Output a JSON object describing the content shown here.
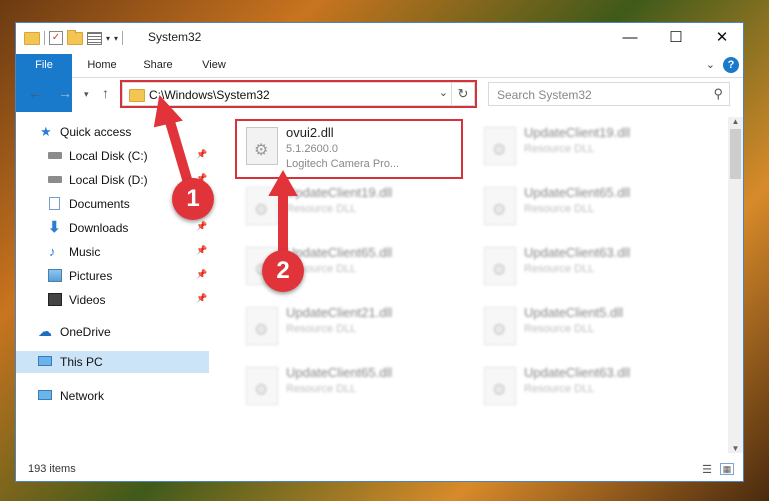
{
  "window": {
    "title": "System32",
    "minimize": "—",
    "maximize": "☐",
    "close": "✕"
  },
  "ribbon": {
    "tabs": [
      "File",
      "Home",
      "Share",
      "View"
    ],
    "help": "?"
  },
  "address": {
    "path": "C:\\Windows\\System32",
    "search_placeholder": "Search System32"
  },
  "nav": {
    "items": [
      {
        "label": "Quick access",
        "icon": "star-icon"
      },
      {
        "label": "Local Disk (C:)",
        "icon": "drive-icon",
        "pinned": true
      },
      {
        "label": "Local Disk (D:)",
        "icon": "drive-icon",
        "pinned": true
      },
      {
        "label": "Documents",
        "icon": "documents-icon",
        "pinned": true
      },
      {
        "label": "Downloads",
        "icon": "download-icon",
        "pinned": true
      },
      {
        "label": "Music",
        "icon": "music-icon",
        "pinned": true
      },
      {
        "label": "Pictures",
        "icon": "pictures-icon",
        "pinned": true
      },
      {
        "label": "Videos",
        "icon": "videos-icon",
        "pinned": true
      },
      {
        "label": "OneDrive",
        "icon": "cloud-icon"
      },
      {
        "label": "This PC",
        "icon": "computer-icon",
        "selected": true
      },
      {
        "label": "Network",
        "icon": "network-icon"
      }
    ]
  },
  "files": {
    "highlighted": {
      "name": "ovui2.dll",
      "version": "5.1.2600.0",
      "description": "Logitech Camera Pro..."
    },
    "blurred": [
      {
        "name": "UpdateClient19.dll",
        "desc": "Resource DLL"
      },
      {
        "name": "UpdateClient19.dll",
        "desc": "Resource DLL"
      },
      {
        "name": "UpdateClient65.dll",
        "desc": "Resource DLL"
      },
      {
        "name": "UpdateClient65.dll",
        "desc": "Resource DLL"
      },
      {
        "name": "UpdateClient63.dll",
        "desc": "Resource DLL"
      },
      {
        "name": "UpdateClient21.dll",
        "desc": "Resource DLL"
      },
      {
        "name": "UpdateClient5.dll",
        "desc": "Resource DLL"
      },
      {
        "name": "UpdateClient65.dll",
        "desc": "Resource DLL"
      },
      {
        "name": "UpdateClient63.dll",
        "desc": "Resource DLL"
      }
    ]
  },
  "status": {
    "item_count": "193 items"
  },
  "annotations": {
    "step1": "1",
    "step2": "2",
    "color": "#e1343a"
  }
}
